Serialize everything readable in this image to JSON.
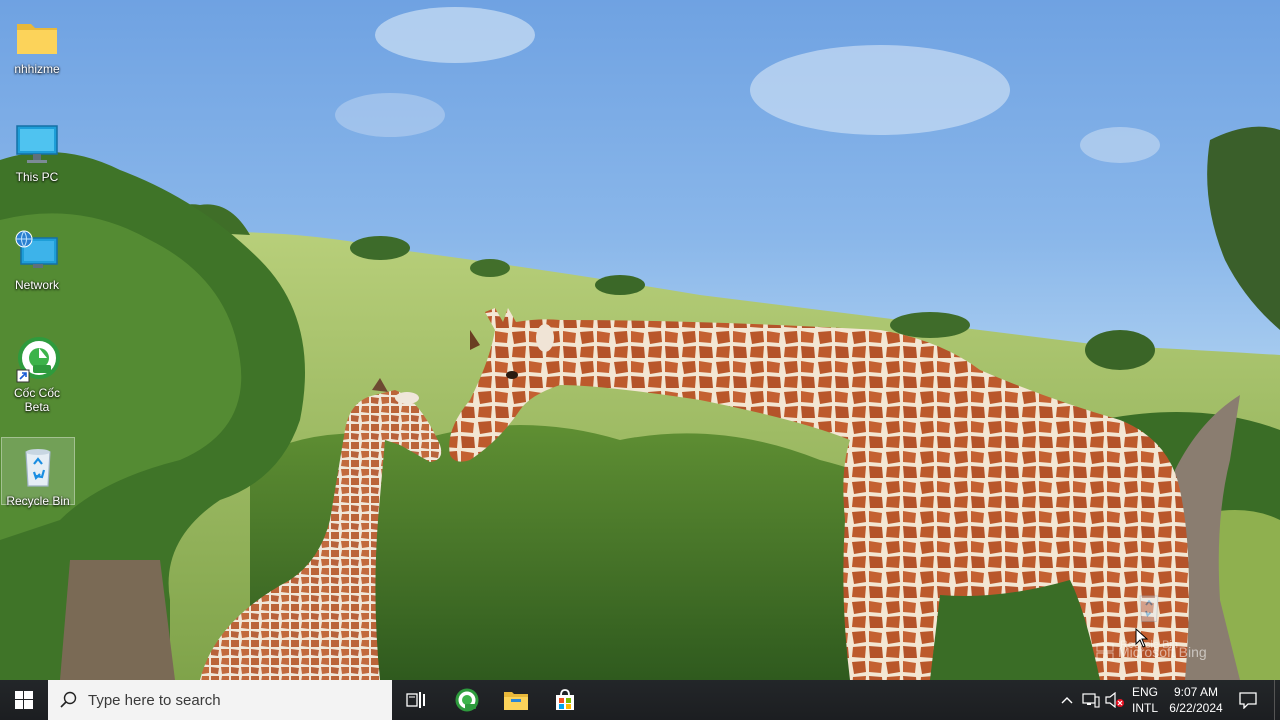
{
  "desktop": {
    "icons": [
      {
        "label": "nhhizme",
        "icon": "folder-icon"
      },
      {
        "label": "This PC",
        "icon": "monitor-icon"
      },
      {
        "label": "Network",
        "icon": "network-icon"
      },
      {
        "label": "Cốc Cốc Beta",
        "icon": "coccoc-icon"
      },
      {
        "label": "Recycle Bin",
        "icon": "recycle-bin-icon"
      }
    ],
    "drag_ghost_label": "Recycle Bin",
    "watermark": "Microsoft Bing"
  },
  "taskbar": {
    "search_placeholder": "Type here to search",
    "lang_top": "ENG",
    "lang_bottom": "INTL",
    "time": "9:07 AM",
    "date": "6/22/2024"
  },
  "colors": {
    "taskbar_bg": "#1f2124",
    "search_bg": "#f3f3f3",
    "accent": "#0078d7"
  }
}
